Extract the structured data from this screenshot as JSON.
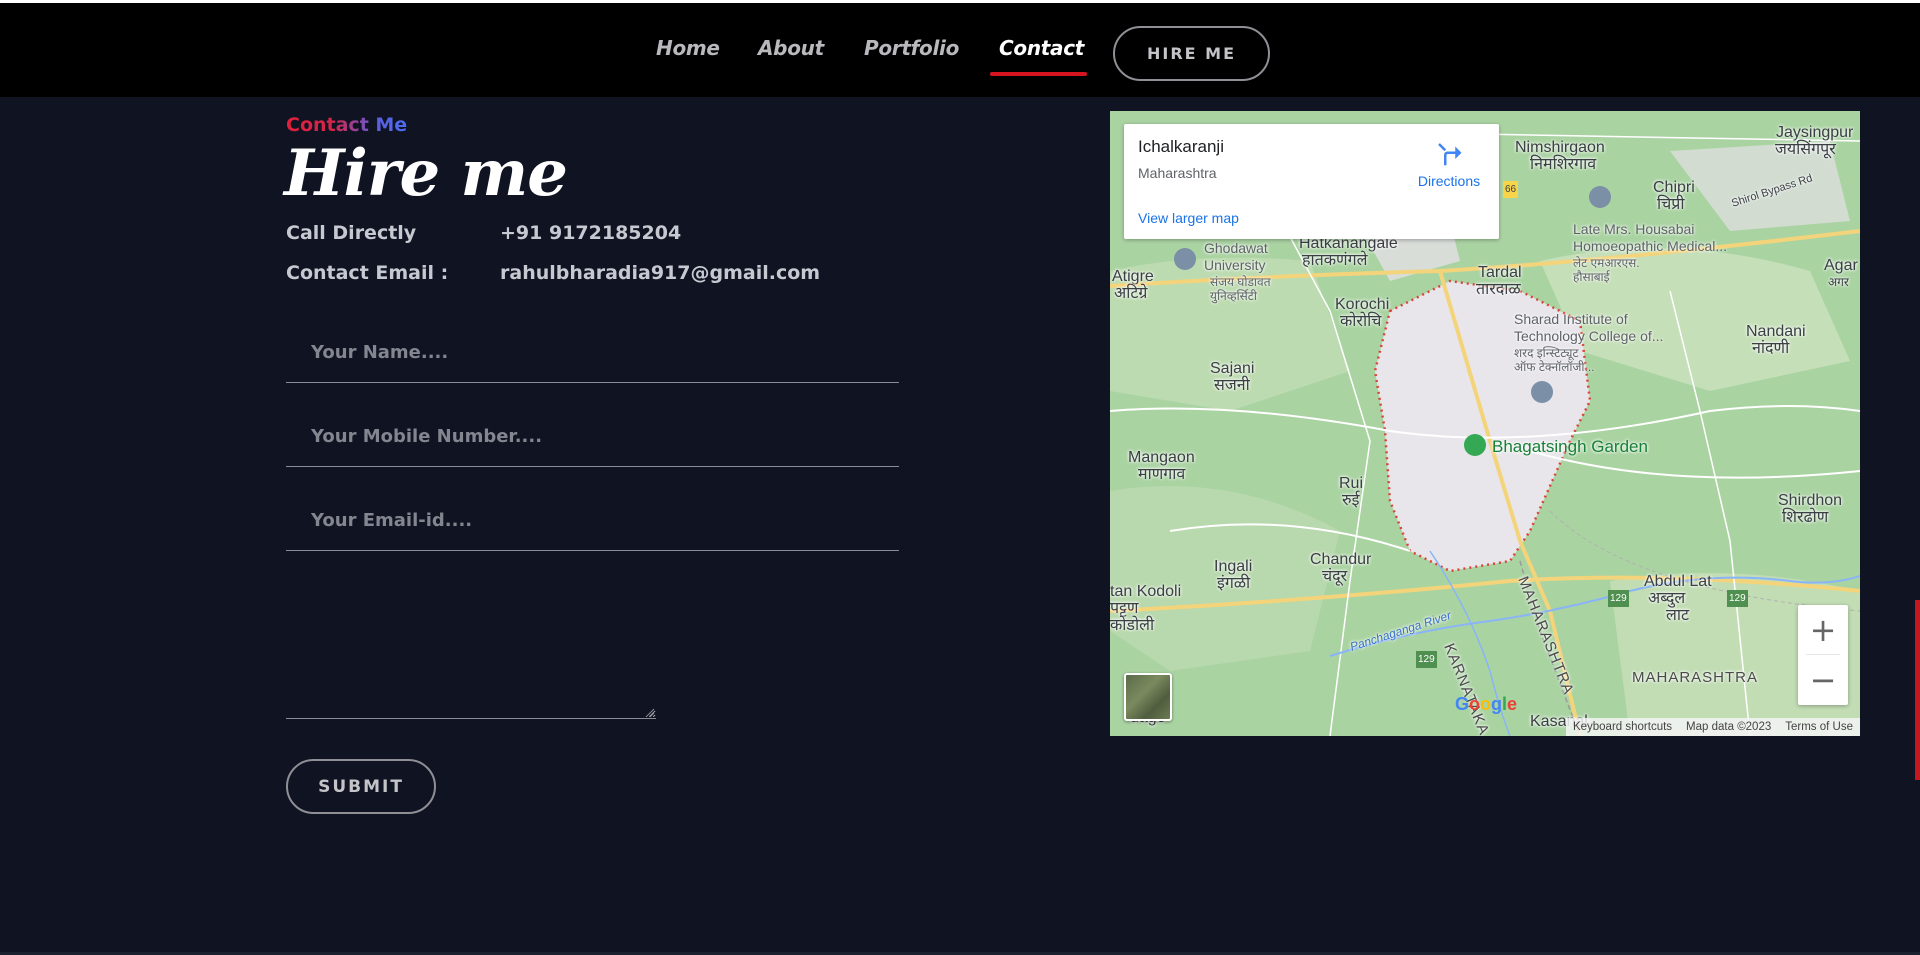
{
  "nav": {
    "items": [
      {
        "label": "Home"
      },
      {
        "label": "About"
      },
      {
        "label": "Portfolio"
      },
      {
        "label": "Contact"
      }
    ],
    "active": "Contact",
    "hire_button": "HIRE ME"
  },
  "contact": {
    "eyebrow": "Contact Me",
    "title": "Hire me",
    "call_label": "Call Directly",
    "call_value": "+91 9172185204",
    "email_label": "Contact Email :",
    "email_value": "rahulbharadia917@gmail.com"
  },
  "form": {
    "name_placeholder": "Your Name....",
    "mobile_placeholder": "Your Mobile Number....",
    "email_placeholder": "Your Email-id....",
    "message_value": "",
    "submit_label": "SUBMIT"
  },
  "map": {
    "card_title": "Ichalkaranji",
    "card_subtitle": "Maharashtra",
    "directions_label": "Directions",
    "larger_map_label": "View larger map",
    "labels": {
      "nimshirgaon": "Nimshirgaon",
      "nimshirgaon_mr": "निमशिरगाव",
      "jaysingpur": "Jaysingpur",
      "jaysingpur_mr": "जयसिंगपूर",
      "chipri": "Chipri",
      "chipri_mr": "चिप्री",
      "housabai": "Late Mrs. Housabai",
      "housabai2": "Homoeopathic Medical...",
      "housabai_mr": "लेट एमआरएस.",
      "housabai_mr2": "हौसाबाई",
      "hatkanangale": "Hatkanangale",
      "hatkanangale_mr": "हातकणंगले",
      "ghodawat": "Ghodawat",
      "ghodawat2": "University",
      "ghodawat_mr": "संजय घोडावत",
      "ghodawat_mr2": "युनिव्हर्सिटी",
      "atigre": "Atigre",
      "atigre_mr": "अटिग्रे",
      "tardal": "Tardal",
      "tardal_mr": "तारदाळ",
      "korochi": "Korochi",
      "korochi_mr": "कोरोचि",
      "sharad": "Sharad Institute of",
      "sharad2": "Technology College of...",
      "sharad_mr": "शरद इन्स्टिट्यूट",
      "sharad_mr2": "ऑफ टेक्नॉलॉजी...",
      "agar": "Agar",
      "agar_mr": "अगर",
      "nandani": "Nandani",
      "nandani_mr": "नांदणी",
      "sajani": "Sajani",
      "sajani_mr": "सजनी",
      "bhagatsingh": "Bhagatsingh Garden",
      "mangaon": "Mangaon",
      "mangaon_mr": "माणगाव",
      "rui": "Rui",
      "rui_mr": "रुई",
      "shirdhon": "Shirdhon",
      "shirdhon_mr": "शिरढोण",
      "ingali": "Ingali",
      "ingali_mr": "इंगळी",
      "chandur": "Chandur",
      "chandur_mr": "चंदूर",
      "abdul_lat": "Abdul Lat",
      "abdul_lat_mr": "अब्दुल",
      "abdul_lat_mr2": "लाट",
      "kodoli": "tan Kodoli",
      "kodoli_mr": "पट्टण",
      "kodoli_mr2": "कोडोली",
      "river": "Panchaganga River",
      "karnataka": "KARNATAKA",
      "maharashtra_v": "MAHARASHTRA",
      "maharashtra_h": "MAHARASHTRA",
      "kasanal": "Kasanal",
      "dage": "dage",
      "shirol_road": "Shirol Bypass Rd",
      "route_66": "66",
      "route_129a": "129",
      "route_129b": "129",
      "route_129c": "129"
    },
    "google": "Google",
    "attribution": [
      "Keyboard shortcuts",
      "Map data ©2023",
      "Terms of Use"
    ]
  },
  "colors": {
    "background": "#0f1322",
    "accent_red": "#d6141f",
    "eyebrow_from": "#e0203a",
    "eyebrow_to": "#4b6cf0"
  }
}
